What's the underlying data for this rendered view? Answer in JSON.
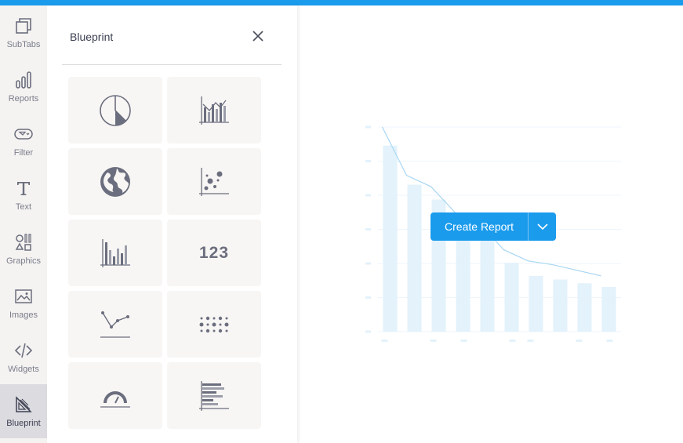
{
  "rail": {
    "items": [
      {
        "label": "SubTabs",
        "icon": "subtabs-icon"
      },
      {
        "label": "Reports",
        "icon": "reports-icon"
      },
      {
        "label": "Filter",
        "icon": "filter-icon"
      },
      {
        "label": "Text",
        "icon": "text-icon"
      },
      {
        "label": "Graphics",
        "icon": "graphics-icon"
      },
      {
        "label": "Images",
        "icon": "images-icon"
      },
      {
        "label": "Widgets",
        "icon": "widgets-icon"
      },
      {
        "label": "Blueprint",
        "icon": "blueprint-icon",
        "active": true
      }
    ]
  },
  "panel": {
    "title": "Blueprint",
    "tiles": [
      {
        "icon": "pie-chart-icon"
      },
      {
        "icon": "bar-line-chart-icon"
      },
      {
        "icon": "globe-icon"
      },
      {
        "icon": "scatter-chart-icon"
      },
      {
        "icon": "bar-chart-icon"
      },
      {
        "icon": "number-icon",
        "text": "123"
      },
      {
        "icon": "line-chart-icon"
      },
      {
        "icon": "dot-matrix-icon"
      },
      {
        "icon": "gauge-icon"
      },
      {
        "icon": "horizontal-bar-icon"
      }
    ]
  },
  "create": {
    "label": "Create Report"
  },
  "colors": {
    "accent": "#1a9bec",
    "icon": "#6b6e7e",
    "placeholder_bar": "#e3f2fb",
    "placeholder_line": "#a9d6f2"
  },
  "chart_data": {
    "type": "bar",
    "categories": [
      "",
      "",
      "",
      "",
      "",
      "",
      "",
      "",
      "",
      ""
    ],
    "values": [
      100,
      79,
      71,
      61,
      57,
      37,
      30,
      28,
      26,
      24
    ],
    "series": [
      {
        "type": "bar",
        "values": [
          100,
          79,
          71,
          61,
          57,
          37,
          30,
          28,
          26,
          24
        ]
      },
      {
        "type": "line",
        "values": [
          110,
          84,
          78,
          64,
          58,
          44,
          38,
          36,
          33,
          30
        ]
      }
    ],
    "ylim": [
      0,
      110
    ],
    "grid": true
  }
}
